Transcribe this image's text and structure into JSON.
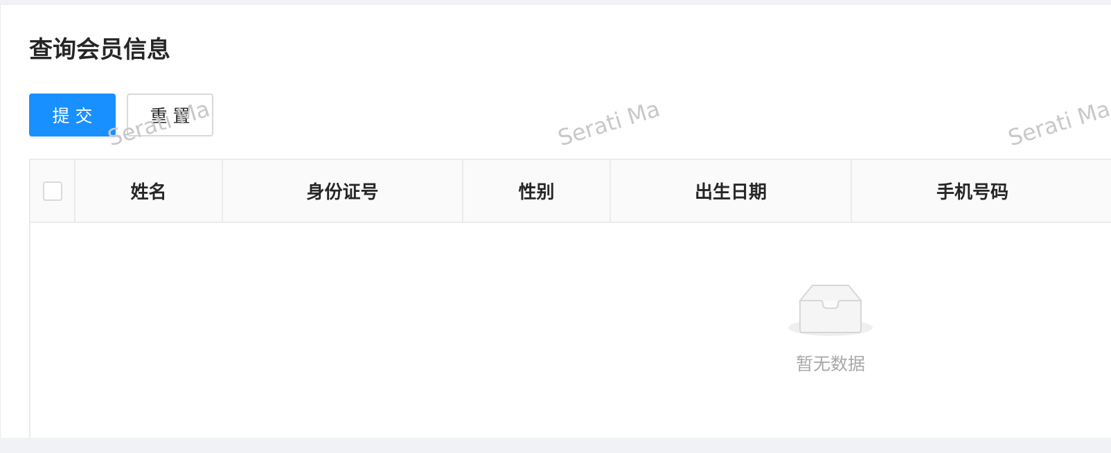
{
  "page": {
    "title": "查询会员信息"
  },
  "toolbar": {
    "submit_label": "提交",
    "reset_label": "重置"
  },
  "table": {
    "columns": [
      "姓名",
      "身份证号",
      "性别",
      "出生日期",
      "手机号码"
    ],
    "rows": [],
    "empty_text": "暂无数据"
  },
  "watermark": {
    "text": "Serati Ma"
  },
  "colors": {
    "primary": "#1890ff",
    "border": "#d9d9d9",
    "header_bg": "#fafafa"
  },
  "icons": {
    "empty": "empty-inbox-icon"
  }
}
